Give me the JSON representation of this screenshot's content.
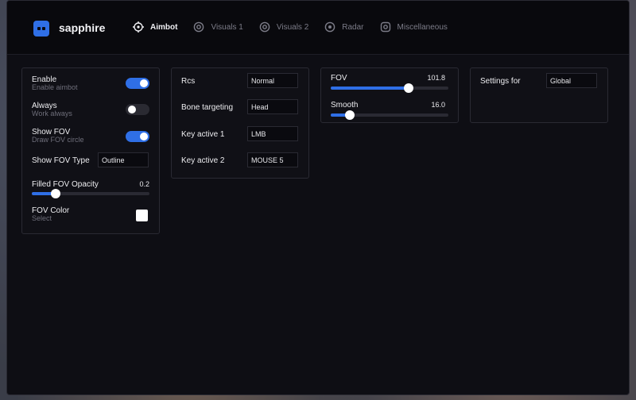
{
  "brand": {
    "name": "sapphire",
    "accent": "#2f6fe6"
  },
  "tabs": [
    {
      "label": "Aimbot",
      "icon": "crosshair-icon",
      "active": true
    },
    {
      "label": "Visuals 1",
      "icon": "eye-icon",
      "active": false
    },
    {
      "label": "Visuals 2",
      "icon": "eye-icon",
      "active": false
    },
    {
      "label": "Radar",
      "icon": "radar-icon",
      "active": false
    },
    {
      "label": "Miscellaneous",
      "icon": "misc-icon",
      "active": false
    }
  ],
  "aimbot_panel": {
    "enable": {
      "label": "Enable",
      "sub": "Enable aimbot",
      "on": true
    },
    "always": {
      "label": "Always",
      "sub": "Work always",
      "on": false
    },
    "show_fov": {
      "label": "Show FOV",
      "sub": "Draw FOV circle",
      "on": true
    },
    "fov_type": {
      "label": "Show FOV Type",
      "value": "Outline"
    },
    "filled_opacity": {
      "label": "Filled FOV Opacity",
      "value": "0.2",
      "fraction": 0.2
    },
    "fov_color": {
      "label": "FOV Color",
      "sub": "Select",
      "color": "#ffffff"
    }
  },
  "targeting_panel": {
    "rcs": {
      "label": "Rcs",
      "value": "Normal"
    },
    "bone": {
      "label": "Bone targeting",
      "value": "Head"
    },
    "key1": {
      "label": "Key active 1",
      "value": "LMB"
    },
    "key2": {
      "label": "Key active 2",
      "value": "MOUSE 5"
    }
  },
  "fov_panel": {
    "fov": {
      "label": "FOV",
      "value": "101.8",
      "fraction": 0.66
    },
    "smooth": {
      "label": "Smooth",
      "value": "16.0",
      "fraction": 0.16
    }
  },
  "settings_panel": {
    "settings_for": {
      "label": "Settings for",
      "value": "Global"
    }
  }
}
